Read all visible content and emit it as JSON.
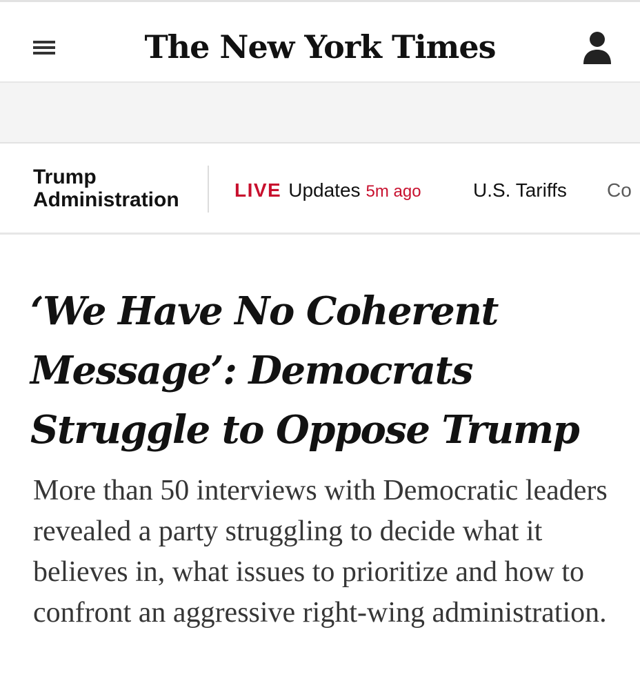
{
  "header": {
    "masthead": "The New York Times",
    "icons": {
      "menu": "hamburger-menu-icon",
      "account": "person-icon"
    }
  },
  "subnav": {
    "section": "Trump Administration",
    "live": {
      "tag": "LIVE",
      "label": "Updates",
      "time": "5m ago"
    },
    "items": [
      "U.S. Tariffs",
      "Co"
    ]
  },
  "article": {
    "headline": "‘We Have No Coherent Message’: Democrats Struggle to Oppose Trump",
    "summary": "More than 50 interviews with Democratic leaders revealed a party struggling to decide what it believes in, what issues to prioritize and how to confront an aggressive right-wing administration."
  },
  "colors": {
    "live_red": "#c8102e",
    "text": "#121212",
    "summary_text": "#363636",
    "ad_band": "#f4f4f4"
  }
}
